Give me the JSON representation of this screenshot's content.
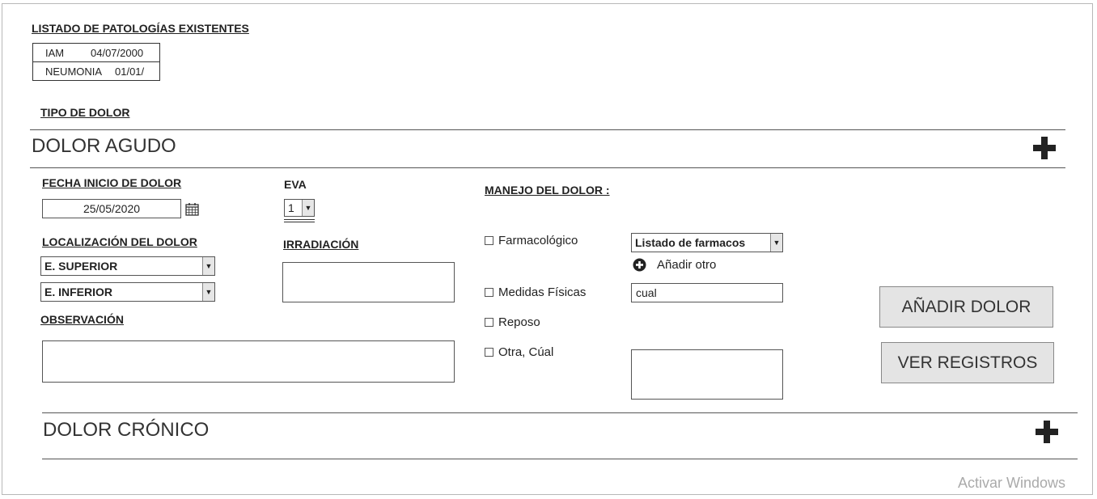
{
  "patologias": {
    "title": "LISTADO DE PATOLOGÍAS EXISTENTES",
    "rows": [
      {
        "name": "IAM",
        "date": "04/07/2000"
      },
      {
        "name": "NEUMONIA",
        "date": "01/01/"
      }
    ]
  },
  "tipo_dolor_label": "TIPO DE DOLOR",
  "dolor_agudo": {
    "title": "DOLOR AGUDO",
    "fecha_label": "FECHA INICIO DE DOLOR",
    "fecha_value": "25/05/2020",
    "eva_label": "EVA",
    "eva_value": "1",
    "localizacion_label": "LOCALIZACIÓN DEL DOLOR",
    "localizacion_1": "E. SUPERIOR",
    "localizacion_2": "E. INFERIOR",
    "irradiacion_label": "IRRADIACIÓN",
    "observacion_label": "OBSERVACIÓN",
    "manejo_label": "MANEJO DEL DOLOR :",
    "farmacologico_label": "Farmacológico",
    "farmacos_select": "Listado de farmacos",
    "anadir_otro_label": "Añadir otro",
    "medidas_label": "Medidas Físicas",
    "cual_value": "cual",
    "reposo_label": "Reposo",
    "otra_label": "Otra, Cúal",
    "anadir_dolor_button": "AÑADIR DOLOR",
    "ver_registros_button": "VER REGISTROS"
  },
  "dolor_cronico": {
    "title": "DOLOR CRÓNICO"
  },
  "watermark": "Activar Windows"
}
